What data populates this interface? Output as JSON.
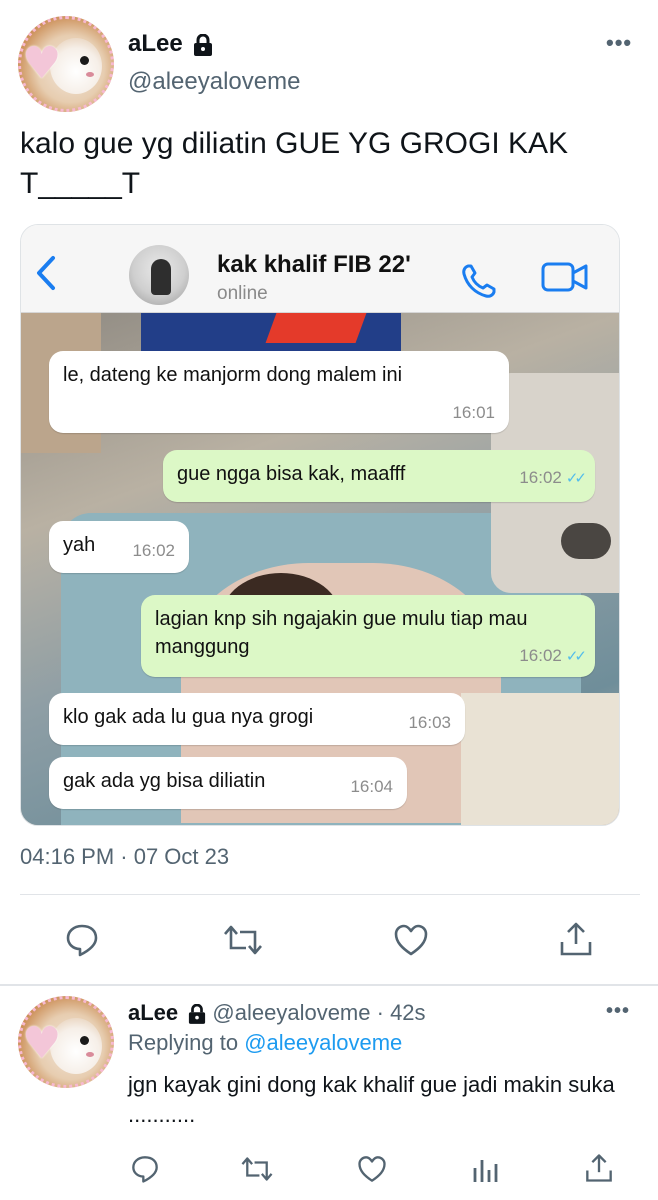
{
  "tweet": {
    "author_name": "aLee",
    "author_handle": "@aleeyaloveme",
    "text": "kalo gue yg diliatin GUE YG GROGI KAK T_____T",
    "timestamp": "04:16 PM · 07 Oct 23"
  },
  "embedded_chat": {
    "contact_name": "kak khalif FIB 22'",
    "contact_status": "online",
    "messages": [
      {
        "direction": "in",
        "text": "le, dateng ke manjorm dong malem ini",
        "time": "16:01"
      },
      {
        "direction": "out",
        "text": "gue ngga bisa kak, maafff",
        "time": "16:02"
      },
      {
        "direction": "in",
        "text": "yah",
        "time": "16:02"
      },
      {
        "direction": "out",
        "text": "lagian knp sih ngajakin gue mulu tiap mau manggung",
        "time": "16:02"
      },
      {
        "direction": "in",
        "text": "klo gak ada lu gua nya grogi",
        "time": "16:03"
      },
      {
        "direction": "in",
        "text": "gak ada yg bisa diliatin",
        "time": "16:04"
      }
    ],
    "read_receipt_color": "#53bdeb"
  },
  "actions": [
    "reply-icon",
    "retweet-icon",
    "like-icon",
    "share-icon"
  ],
  "reply": {
    "author_name": "aLee",
    "author_handle": "@aleeyaloveme",
    "age": "· 42s",
    "replying_prefix": "Replying to",
    "replying_to": "@aleeyaloveme",
    "text": "jgn kayak gini dong kak khalif gue jadi makin suka ...........",
    "actions": [
      "reply-icon",
      "retweet-icon",
      "like-icon",
      "analytics-icon",
      "share-icon"
    ]
  },
  "colors": {
    "accent": "#1d9bf0",
    "secondary_text": "#536471",
    "whatsapp_blue": "#1a7df0",
    "outgoing_bubble": "#dcf8c6"
  }
}
